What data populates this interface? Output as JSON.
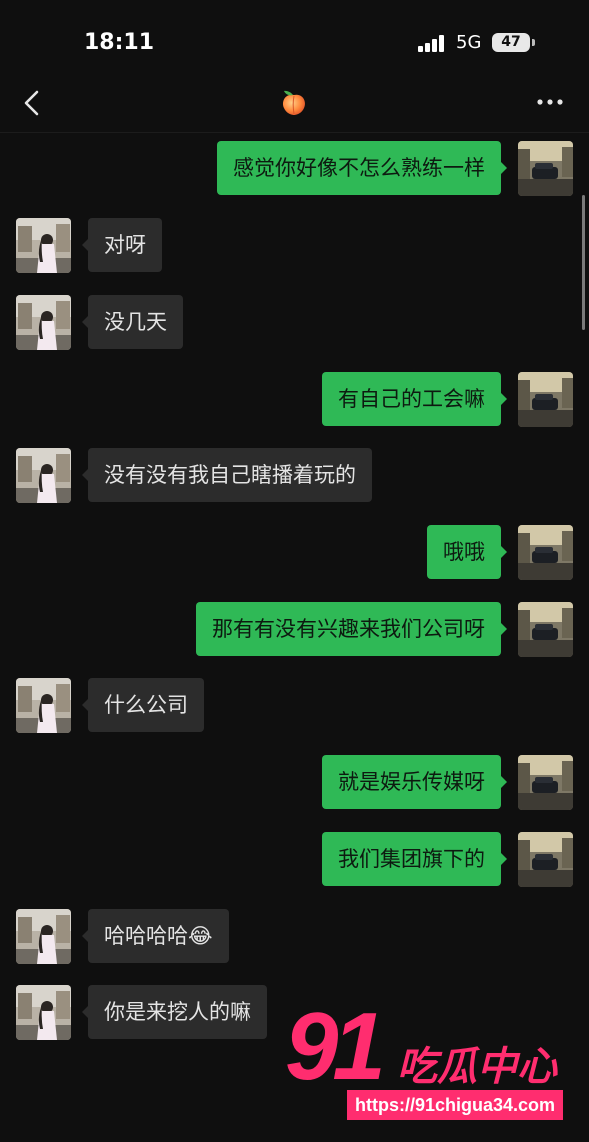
{
  "status_bar": {
    "time": "18:11",
    "network": "5G",
    "battery": "47"
  },
  "nav": {
    "title_icon": "peach-icon",
    "back_icon": "chevron-left-icon",
    "more_icon": "more-dots-icon"
  },
  "colors": {
    "background": "#0f0f0f",
    "sent_bubble": "#2fb956",
    "received_bubble": "#2c2c2c"
  },
  "messages": [
    {
      "side": "right",
      "text": "感觉你好像不怎么熟练一样"
    },
    {
      "side": "left",
      "text": "对呀"
    },
    {
      "side": "left",
      "text": "没几天"
    },
    {
      "side": "right",
      "text": "有自己的工会嘛"
    },
    {
      "side": "left",
      "text": "没有没有我自己瞎播着玩的"
    },
    {
      "side": "right",
      "text": "哦哦"
    },
    {
      "side": "right",
      "text": "那有有没有兴趣来我们公司呀"
    },
    {
      "side": "left",
      "text": "什么公司"
    },
    {
      "side": "right",
      "text": "就是娱乐传媒呀"
    },
    {
      "side": "right",
      "text": "我们集团旗下的"
    },
    {
      "side": "left",
      "text": "哈哈哈哈😂"
    },
    {
      "side": "left",
      "text": "你是来挖人的嘛"
    }
  ],
  "watermark": {
    "number": "91",
    "brand": "吃瓜中心",
    "url": "https://91chigua34.com"
  }
}
